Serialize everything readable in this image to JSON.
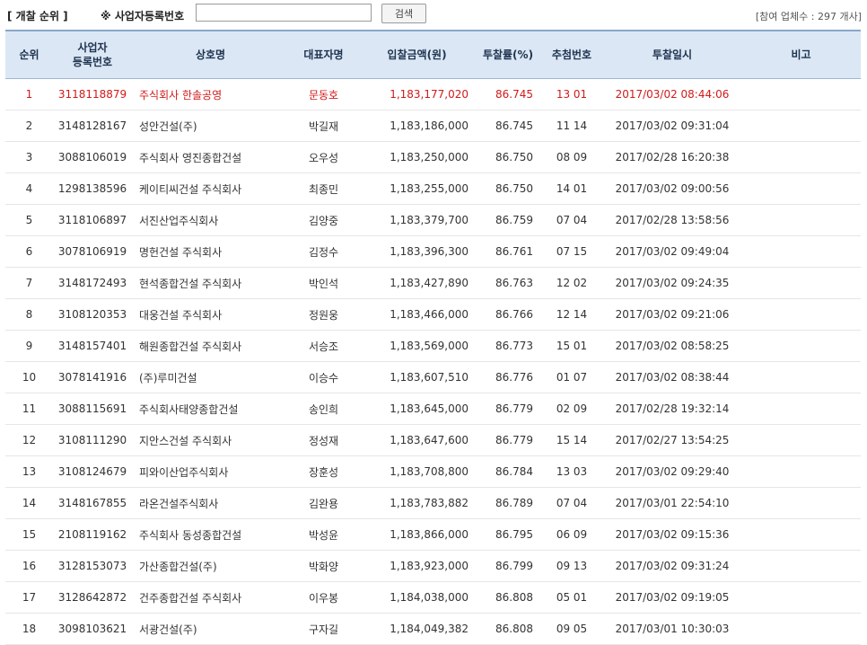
{
  "header": {
    "section_title": "[ 개찰 순위 ]",
    "search_label": "※ 사업자등록번호",
    "search_value": "",
    "search_button": "검색",
    "participant_count": "[참여 업체수 : 297 개사]"
  },
  "table": {
    "columns": {
      "rank": "순위",
      "bizno_line1": "사업자",
      "bizno_line2": "등록번호",
      "company": "상호명",
      "ceo": "대표자명",
      "bid_amount": "입찰금액(원)",
      "bid_rate": "투찰률(%)",
      "lottery": "추첨번호",
      "bid_time": "투찰일시",
      "note": "비고"
    },
    "rows": [
      {
        "rank": "1",
        "bizno": "3118118879",
        "company": "주식회사 한솔공영",
        "ceo": "문동호",
        "amount": "1,183,177,020",
        "rate": "86.745",
        "lottery": "13 01",
        "time": "2017/03/02 08:44:06",
        "note": ""
      },
      {
        "rank": "2",
        "bizno": "3148128167",
        "company": "성안건설(주)",
        "ceo": "박길재",
        "amount": "1,183,186,000",
        "rate": "86.745",
        "lottery": "11 14",
        "time": "2017/03/02 09:31:04",
        "note": ""
      },
      {
        "rank": "3",
        "bizno": "3088106019",
        "company": "주식회사 영진종합건설",
        "ceo": "오우성",
        "amount": "1,183,250,000",
        "rate": "86.750",
        "lottery": "08 09",
        "time": "2017/02/28 16:20:38",
        "note": ""
      },
      {
        "rank": "4",
        "bizno": "1298138596",
        "company": "케이티씨건설 주식회사",
        "ceo": "최종민",
        "amount": "1,183,255,000",
        "rate": "86.750",
        "lottery": "14 01",
        "time": "2017/03/02 09:00:56",
        "note": ""
      },
      {
        "rank": "5",
        "bizno": "3118106897",
        "company": "서진산업주식회사",
        "ceo": "김양중",
        "amount": "1,183,379,700",
        "rate": "86.759",
        "lottery": "07 04",
        "time": "2017/02/28 13:58:56",
        "note": ""
      },
      {
        "rank": "6",
        "bizno": "3078106919",
        "company": "명헌건설 주식회사",
        "ceo": "김정수",
        "amount": "1,183,396,300",
        "rate": "86.761",
        "lottery": "07 15",
        "time": "2017/03/02 09:49:04",
        "note": ""
      },
      {
        "rank": "7",
        "bizno": "3148172493",
        "company": "현석종합건설 주식회사",
        "ceo": "박인석",
        "amount": "1,183,427,890",
        "rate": "86.763",
        "lottery": "12 02",
        "time": "2017/03/02 09:24:35",
        "note": ""
      },
      {
        "rank": "8",
        "bizno": "3108120353",
        "company": "대웅건설 주식회사",
        "ceo": "정원웅",
        "amount": "1,183,466,000",
        "rate": "86.766",
        "lottery": "12 14",
        "time": "2017/03/02 09:21:06",
        "note": ""
      },
      {
        "rank": "9",
        "bizno": "3148157401",
        "company": "해원종합건설 주식회사",
        "ceo": "서승조",
        "amount": "1,183,569,000",
        "rate": "86.773",
        "lottery": "15 01",
        "time": "2017/03/02 08:58:25",
        "note": ""
      },
      {
        "rank": "10",
        "bizno": "3078141916",
        "company": "(주)루미건설",
        "ceo": "이승수",
        "amount": "1,183,607,510",
        "rate": "86.776",
        "lottery": "01 07",
        "time": "2017/03/02 08:38:44",
        "note": ""
      },
      {
        "rank": "11",
        "bizno": "3088115691",
        "company": "주식회사태양종합건설",
        "ceo": "송인희",
        "amount": "1,183,645,000",
        "rate": "86.779",
        "lottery": "02 09",
        "time": "2017/02/28 19:32:14",
        "note": ""
      },
      {
        "rank": "12",
        "bizno": "3108111290",
        "company": "지안스건설 주식회사",
        "ceo": "정성재",
        "amount": "1,183,647,600",
        "rate": "86.779",
        "lottery": "15 14",
        "time": "2017/02/27 13:54:25",
        "note": ""
      },
      {
        "rank": "13",
        "bizno": "3108124679",
        "company": "피와이산업주식회사",
        "ceo": "장훈성",
        "amount": "1,183,708,800",
        "rate": "86.784",
        "lottery": "13 03",
        "time": "2017/03/02 09:29:40",
        "note": ""
      },
      {
        "rank": "14",
        "bizno": "3148167855",
        "company": "라온건설주식회사",
        "ceo": "김완용",
        "amount": "1,183,783,882",
        "rate": "86.789",
        "lottery": "07 04",
        "time": "2017/03/01 22:54:10",
        "note": ""
      },
      {
        "rank": "15",
        "bizno": "2108119162",
        "company": "주식회사 동성종합건설",
        "ceo": "박성윤",
        "amount": "1,183,866,000",
        "rate": "86.795",
        "lottery": "06 09",
        "time": "2017/03/02 09:15:36",
        "note": ""
      },
      {
        "rank": "16",
        "bizno": "3128153073",
        "company": "가산종합건설(주)",
        "ceo": "박화양",
        "amount": "1,183,923,000",
        "rate": "86.799",
        "lottery": "09 13",
        "time": "2017/03/02 09:31:24",
        "note": ""
      },
      {
        "rank": "17",
        "bizno": "3128642872",
        "company": "건주종합건설 주식회사",
        "ceo": "이우봉",
        "amount": "1,184,038,000",
        "rate": "86.808",
        "lottery": "05 01",
        "time": "2017/03/02 09:19:05",
        "note": ""
      },
      {
        "rank": "18",
        "bizno": "3098103621",
        "company": "서광건설(주)",
        "ceo": "구자길",
        "amount": "1,184,049,382",
        "rate": "86.808",
        "lottery": "09 05",
        "time": "2017/03/01 10:30:03",
        "note": ""
      }
    ]
  },
  "colors": {
    "header_bg": "#dbe7f4",
    "winner_text": "#d11a1a"
  }
}
